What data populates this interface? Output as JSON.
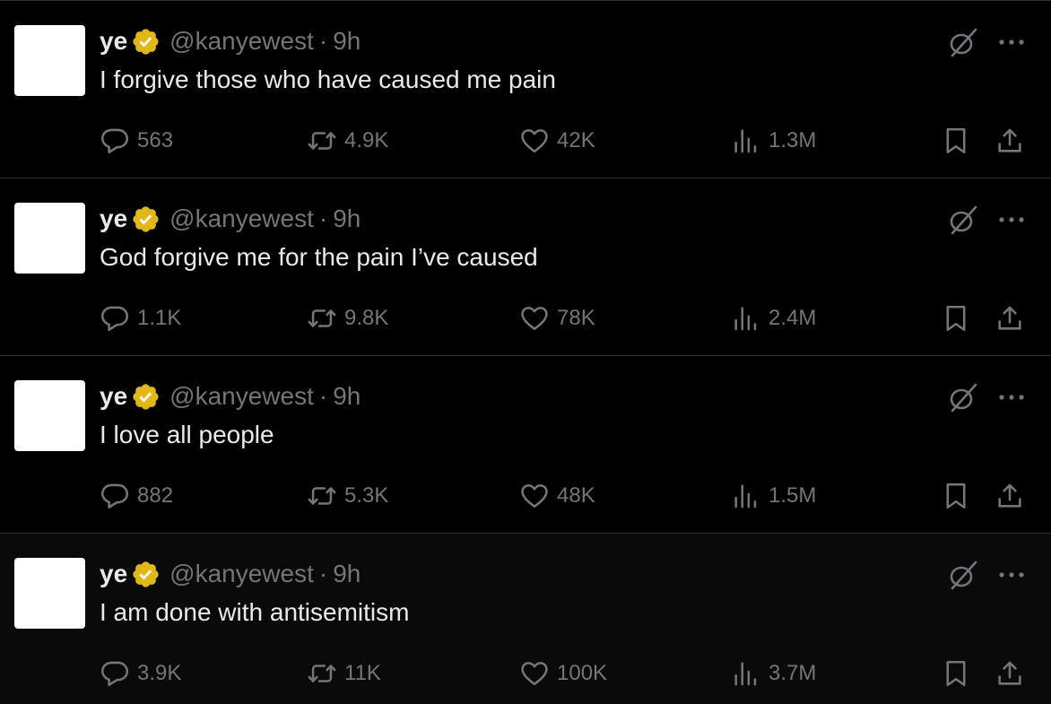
{
  "colors": {
    "background": "#000000",
    "text_primary": "#e7e9ea",
    "text_secondary": "#71767b",
    "divider": "#2f3336",
    "verified_badge": "#e2b719"
  },
  "tweets": [
    {
      "author": {
        "name": "ye",
        "handle": "@kanyewest",
        "verified": true,
        "verified_icon": "gold-verified-badge-icon"
      },
      "separator": "·",
      "time": "9h",
      "text": "I forgive those who have caused me pain",
      "stats": {
        "replies": "563",
        "reposts": "4.9K",
        "likes": "42K",
        "views": "1.3M"
      }
    },
    {
      "author": {
        "name": "ye",
        "handle": "@kanyewest",
        "verified": true,
        "verified_icon": "gold-verified-badge-icon"
      },
      "separator": "·",
      "time": "9h",
      "text": "God forgive me for the pain I’ve caused",
      "stats": {
        "replies": "1.1K",
        "reposts": "9.8K",
        "likes": "78K",
        "views": "2.4M"
      }
    },
    {
      "author": {
        "name": "ye",
        "handle": "@kanyewest",
        "verified": true,
        "verified_icon": "gold-verified-badge-icon"
      },
      "separator": "·",
      "time": "9h",
      "text": "I love all people",
      "stats": {
        "replies": "882",
        "reposts": "5.3K",
        "likes": "48K",
        "views": "1.5M"
      }
    },
    {
      "author": {
        "name": "ye",
        "handle": "@kanyewest",
        "verified": true,
        "verified_icon": "gold-verified-badge-icon"
      },
      "separator": "·",
      "time": "9h",
      "text": "I am done with antisemitism",
      "stats": {
        "replies": "3.9K",
        "reposts": "11K",
        "likes": "100K",
        "views": "3.7M"
      }
    }
  ],
  "icons": {
    "grok": "grok-icon",
    "more": "more-options-icon",
    "reply": "reply-icon",
    "repost": "repost-icon",
    "like": "heart-icon",
    "views": "views-chart-icon",
    "bookmark": "bookmark-icon",
    "share": "share-icon"
  }
}
